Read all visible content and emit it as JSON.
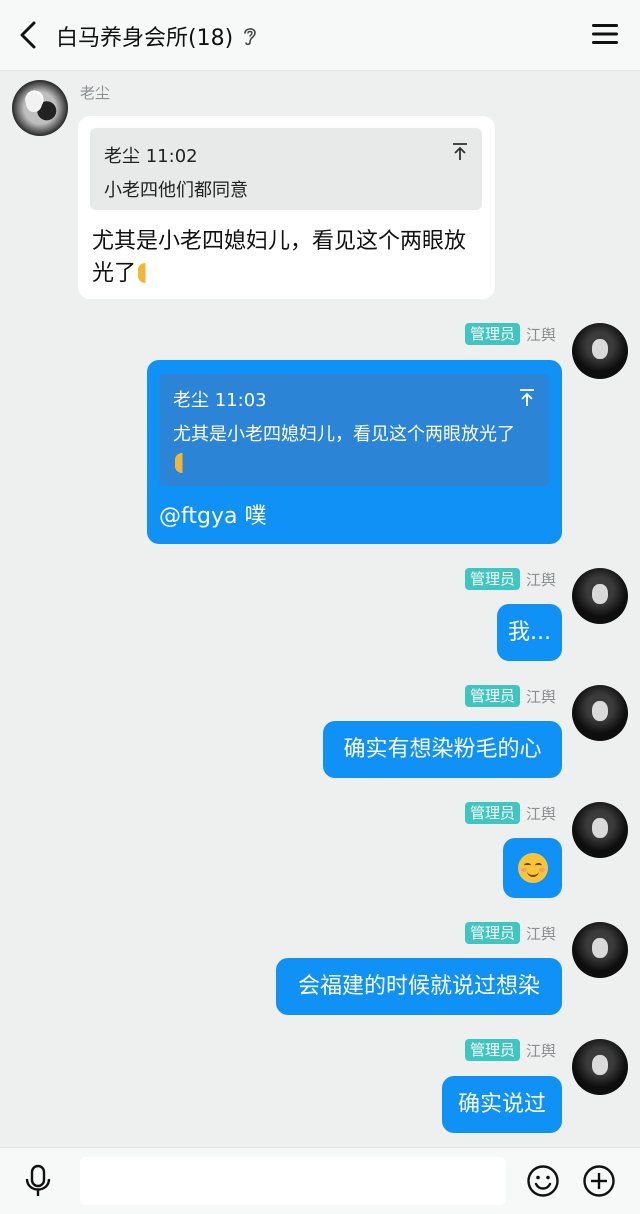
{
  "header": {
    "title": "白马养身会所(18)",
    "back_icon": "chevron-left-icon",
    "ear_icon": "ear-icon",
    "menu_icon": "hamburger-menu-icon"
  },
  "messages": [
    {
      "sender": "老尘",
      "side": "left",
      "quote": {
        "author_time": "老尘 11:02",
        "text": "小老四他们都同意"
      },
      "text": "尤其是小老四媳妇儿，看见这个两眼放光了"
    },
    {
      "sender": "江舆",
      "role_badge": "管理员",
      "side": "right",
      "quote": {
        "author_time": "老尘 11:03",
        "text": "尤其是小老四媳妇儿，看见这个两眼放光了"
      },
      "text": "@ftgya 噗"
    },
    {
      "sender": "江舆",
      "role_badge": "管理员",
      "side": "right",
      "text": "我..."
    },
    {
      "sender": "江舆",
      "role_badge": "管理员",
      "side": "right",
      "text": "确实有想染粉毛的心"
    },
    {
      "sender": "江舆",
      "role_badge": "管理员",
      "side": "right",
      "emoji": "blushing-smile-emoji"
    },
    {
      "sender": "江舆",
      "role_badge": "管理员",
      "side": "right",
      "text": "会福建的时候就说过想染"
    },
    {
      "sender": "江舆",
      "role_badge": "管理员",
      "side": "right",
      "text": "确实说过"
    }
  ],
  "composer": {
    "input_value": "",
    "mic_icon": "microphone-icon",
    "emoji_icon": "smiley-icon",
    "plus_icon": "plus-circle-icon"
  },
  "colors": {
    "background": "#edf0ef",
    "bubble_blue": "#0f91f5",
    "quote_blue": "#2b84d6",
    "admin_badge": "#3fc6c0"
  }
}
